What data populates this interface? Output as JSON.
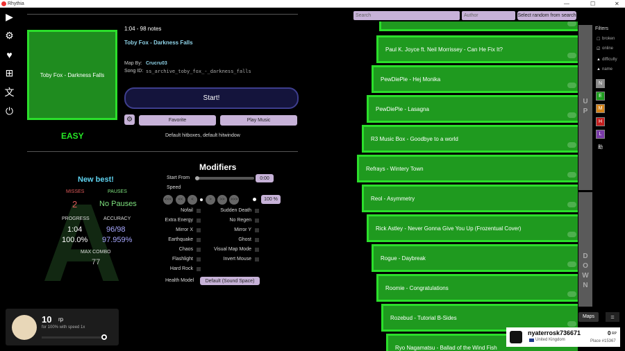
{
  "window": {
    "title": "Rhythia",
    "minimize": "—",
    "maximize": "☐",
    "close": "✕"
  },
  "sidebar": {
    "items": [
      {
        "icon": "play-icon",
        "glyph": "▶"
      },
      {
        "icon": "gear-icon",
        "glyph": "⚙"
      },
      {
        "icon": "heart-icon",
        "glyph": "♥"
      },
      {
        "icon": "add-icon",
        "glyph": "⊞"
      },
      {
        "icon": "translate-icon",
        "glyph": "文"
      },
      {
        "icon": "power-icon",
        "glyph": "⏻"
      }
    ]
  },
  "map": {
    "cover_text": "Toby Fox - Darkness Falls",
    "difficulty": "EASY",
    "length_notes": "1:04 - 98 notes",
    "title": "Toby Fox - Darkness Falls",
    "mapper_label": "Map By:",
    "mapper": "Crucru03",
    "song_id_label": "Song ID:",
    "song_id": "ss_archive_toby_fox_-_darkness_falls",
    "start_label": "Start!",
    "favorite_label": "Favorite",
    "play_music_label": "Play Music",
    "hitbox_text": "Default hitboxes, default hitwindow"
  },
  "stats": {
    "new_best": "New best!",
    "misses_label": "MISSES",
    "misses": "2",
    "pauses_label": "PAUSES",
    "pauses": "No Pauses",
    "progress_label": "PROGRESS",
    "progress_time": "1:04",
    "progress_pct": "100.0%",
    "accuracy_label": "ACCURACY",
    "accuracy_hits": "96/98",
    "accuracy_pct": "97.959%",
    "max_combo_label": "MAX COMBO",
    "max_combo": "77"
  },
  "modifiers": {
    "title": "Modifiers",
    "start_from_label": "Start From",
    "start_from_value": "0:00",
    "speed_label": "Speed",
    "speed_value": "100 %",
    "speed_buttons": [
      "<<<",
      "<<",
      "<",
      ">",
      ">>",
      ">>>"
    ],
    "left": [
      "Nofail",
      "Extra Energy",
      "Mirror X",
      "Earthquake",
      "Chaos",
      "Flashlight",
      "Hard Rock"
    ],
    "right": [
      "Sudden Death",
      "No Regen",
      "Mirror Y",
      "Ghost",
      "Visual Map Mode",
      "Invert Mouse"
    ],
    "health_label": "Health Model",
    "health_value": "Default (Sound Space)"
  },
  "search": {
    "placeholder": "Search",
    "author_placeholder": "Author",
    "random_label": "Select random from search"
  },
  "songs": [
    "",
    "Paul K. Joyce ft. Neil Morrissey - Can He Fix It?",
    "PewDiePie - Hej Monika",
    "PewDiePie - Lasagna",
    "R3 Music Box - Goodbye to a world",
    "Refrays - Wintery Town",
    "Reol - Asymmetry",
    "Rick Astley - Never Gonna Give You Up (Frozentual Cover)",
    "Rogue - Daybreak",
    "Roomie - Congratulations",
    "Rozebud - Tutorial B-Sides",
    "Ryo Nagamatsu - Ballad of the Wind Fish"
  ],
  "scroll": {
    "up": [
      "U",
      "P"
    ],
    "down": [
      "D",
      "O",
      "W",
      "N"
    ]
  },
  "filters": {
    "title": "Filters",
    "options": [
      "broken",
      "online",
      "difficulty",
      "name"
    ],
    "difficulty_buttons": [
      {
        "label": "N",
        "color": "#8a8a8a"
      },
      {
        "label": "E",
        "color": "#1e9e1e"
      },
      {
        "label": "M",
        "color": "#d4831a"
      },
      {
        "label": "H",
        "color": "#c41e1e"
      },
      {
        "label": "L",
        "color": "#7a3aa8"
      },
      {
        "label": "助",
        "color": "#000000"
      }
    ]
  },
  "rp": {
    "value": "10",
    "unit": "rp",
    "caption": "for 100% with speed 1x"
  },
  "profile": {
    "name": "nyaterrosk736671",
    "country": "United Kingdom",
    "rp": "0",
    "rp_unit": "RP",
    "place": "Place #15367"
  },
  "bottom": {
    "maps_label": "Maps",
    "menu_glyph": "="
  },
  "colors": {
    "accent": "#2bdf2b",
    "button": "#c7b2d8",
    "start": "#14143c"
  }
}
